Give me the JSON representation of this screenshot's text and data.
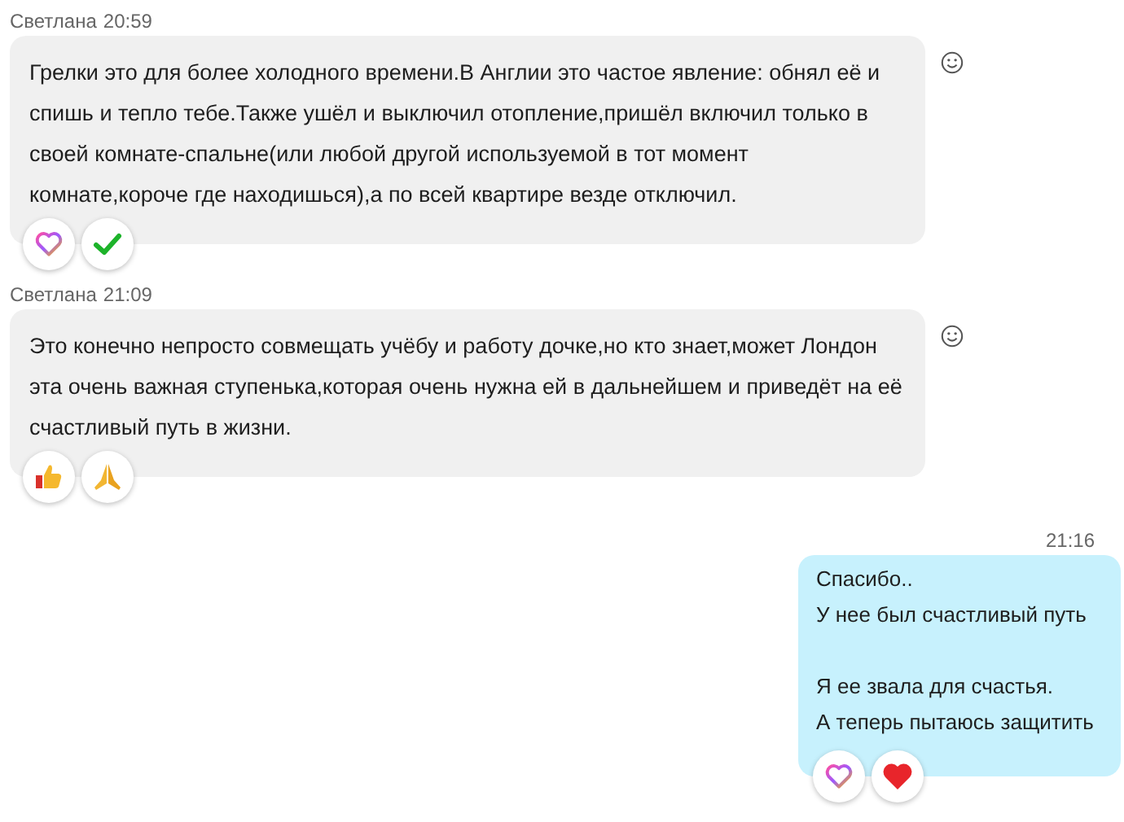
{
  "messages": [
    {
      "kind": "incoming",
      "sender": "Светлана",
      "time": "20:59",
      "text": "Грелки это для более холодного времени.В Англии это частое явление: обнял её и спишь и тепло тебе.Также ушёл и выключил отопление,пришёл включил только в своей комнате-спальне(или любой другой используемой в тот момент комнате,короче где находишься),а по всей квартире везде отключил.",
      "reactions": [
        {
          "kind": "heart"
        },
        {
          "kind": "check"
        }
      ]
    },
    {
      "kind": "incoming",
      "sender": "Светлана",
      "time": "21:09",
      "text": "Это конечно непросто совмещать учёбу и работу дочке,но кто знает,может Лондон эта очень важная ступенька,которая очень нужна ей в дальнейшем и приведёт на её счастливый путь в жизни.",
      "reactions": [
        {
          "kind": "thumbs"
        },
        {
          "kind": "pray"
        }
      ]
    },
    {
      "kind": "outgoing",
      "time": "21:16",
      "text": "Спасибо..\nУ нее был счастливый путь\n\nЯ ее звала для счастья.\nА теперь пытаюсь защитить",
      "reactions": [
        {
          "kind": "heart"
        },
        {
          "kind": "red-heart"
        }
      ]
    }
  ]
}
